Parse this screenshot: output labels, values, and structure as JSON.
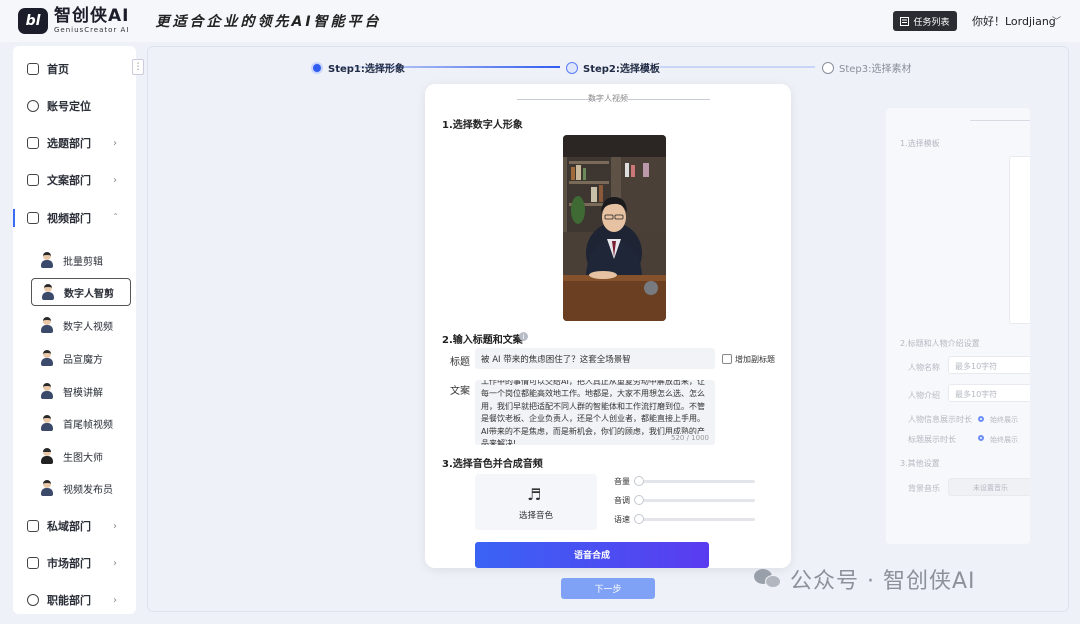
{
  "header": {
    "logo_mark": "bl",
    "logo_name": "智创侠AI",
    "logo_sub": "GeniusCreator AI",
    "slogan": "更适合企业的领先AI智能平台",
    "task_button": "任务列表",
    "greeting": "你好！Lordjiang"
  },
  "sidebar": {
    "items": [
      {
        "label": "首页",
        "icon": "home-icon"
      },
      {
        "label": "账号定位",
        "icon": "target-icon"
      },
      {
        "label": "选题部门",
        "icon": "topic-icon"
      },
      {
        "label": "文案部门",
        "icon": "document-icon"
      },
      {
        "label": "视频部门",
        "icon": "video-icon"
      },
      {
        "label": "私域部门",
        "icon": "chat-icon"
      },
      {
        "label": "市场部门",
        "icon": "market-icon"
      },
      {
        "label": "职能部门",
        "icon": "function-icon"
      }
    ],
    "video_subitems": [
      {
        "label": "批量剪辑"
      },
      {
        "label": "数字人智剪",
        "selected": true
      },
      {
        "label": "数字人视频"
      },
      {
        "label": "品宣魔方"
      },
      {
        "label": "智模讲解"
      },
      {
        "label": "首尾帧视频"
      },
      {
        "label": "生图大师"
      },
      {
        "label": "视频发布员"
      }
    ]
  },
  "steps": [
    {
      "label": "Step1:选择形象",
      "state": "done"
    },
    {
      "label": "Step2:选择模板",
      "state": "current"
    },
    {
      "label": "Step3:选择素材",
      "state": "pending"
    }
  ],
  "modal": {
    "header": "数字人视频",
    "section1": "1.选择数字人形象",
    "section2": "2.输入标题和文案",
    "title_label": "标题",
    "title_value": "被 AI 带来的焦虑困住了？这套全场景智",
    "subtitle_checkbox": "增加副标题",
    "copy_label": "文案",
    "copy_text": "工作中的事情可以交给AI，把人真正从重复劳动中解放出来，让每一个岗位都能高效地工作。地都是，大家不用想怎么选、怎么用，我们早就把适配不同人群的智能体和工作流打磨到位。不管是餐饮老板、企业负责人，还是个人创业者，都能直接上手用。AI带来的不是焦虑，而是新机会，你们的顾虑，我们用成熟的产品来解决!",
    "copy_count": "520 / 1000",
    "section3": "3.选择音色并合成音频",
    "voice_button": "选择音色",
    "sliders": [
      {
        "label": "音量",
        "value": 0
      },
      {
        "label": "音调",
        "value": 0
      },
      {
        "label": "语速",
        "value": 0
      }
    ],
    "synth_button": "语音合成"
  },
  "next_button": "下一步",
  "preview": {
    "section1": "1.选择模板",
    "section2": "2.标题和人物介绍设置",
    "name_label": "人物名称",
    "name_placeholder": "最多10字符",
    "intro_label": "人物介绍",
    "intro_placeholder": "最多10字符",
    "info_time_label": "人物信息展示时长",
    "info_time_value": "始终展示",
    "title_time_label": "标题展示时长",
    "title_time_value": "始终展示",
    "section3": "3.其他设置",
    "music_label": "背景音乐",
    "music_value": "未设置音乐"
  },
  "watermark": "公众号 · 智创侠AI",
  "colors": {
    "accent": "#3a6cf5",
    "dark": "#2b2d33",
    "next": "#7fa2f6"
  }
}
